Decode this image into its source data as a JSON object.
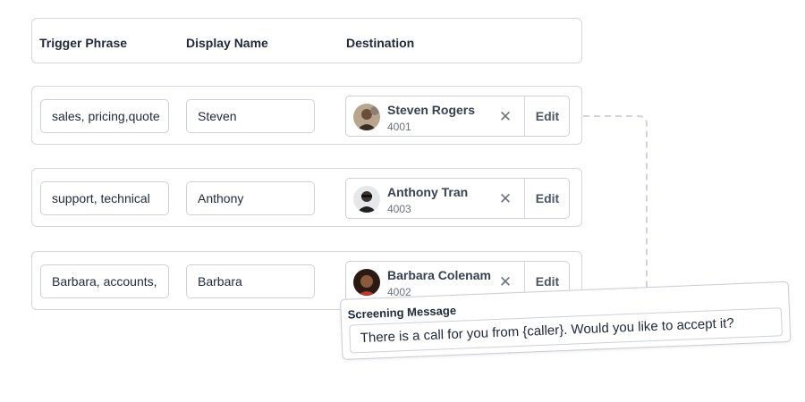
{
  "header": {
    "trigger_phrase": "Trigger Phrase",
    "display_name": "Display Name",
    "destination": "Destination"
  },
  "rows": [
    {
      "trigger": "sales, pricing,quote",
      "display_name": "Steven",
      "destination": {
        "name": "Steven Rogers",
        "extension": "4001",
        "avatar_icon": "person-avatar"
      },
      "remove_symbol": "✕",
      "edit_label": "Edit"
    },
    {
      "trigger": "support, technical",
      "display_name": "Anthony",
      "destination": {
        "name": "Anthony Tran",
        "extension": "4003",
        "avatar_icon": "person-avatar"
      },
      "remove_symbol": "✕",
      "edit_label": "Edit"
    },
    {
      "trigger": "Barbara, accounts,",
      "display_name": "Barbara",
      "destination": {
        "name": "Barbara Colenam",
        "extension": "4002",
        "avatar_icon": "person-avatar"
      },
      "remove_symbol": "✕",
      "edit_label": "Edit"
    }
  ],
  "screening": {
    "label": "Screening Message",
    "value": "There is a call for you from {caller}. Would you like to accept it?"
  },
  "colors": {
    "border": "#d4d7dd",
    "text": "#1f2937",
    "muted": "#6b7280",
    "connector": "#d1d5db"
  }
}
